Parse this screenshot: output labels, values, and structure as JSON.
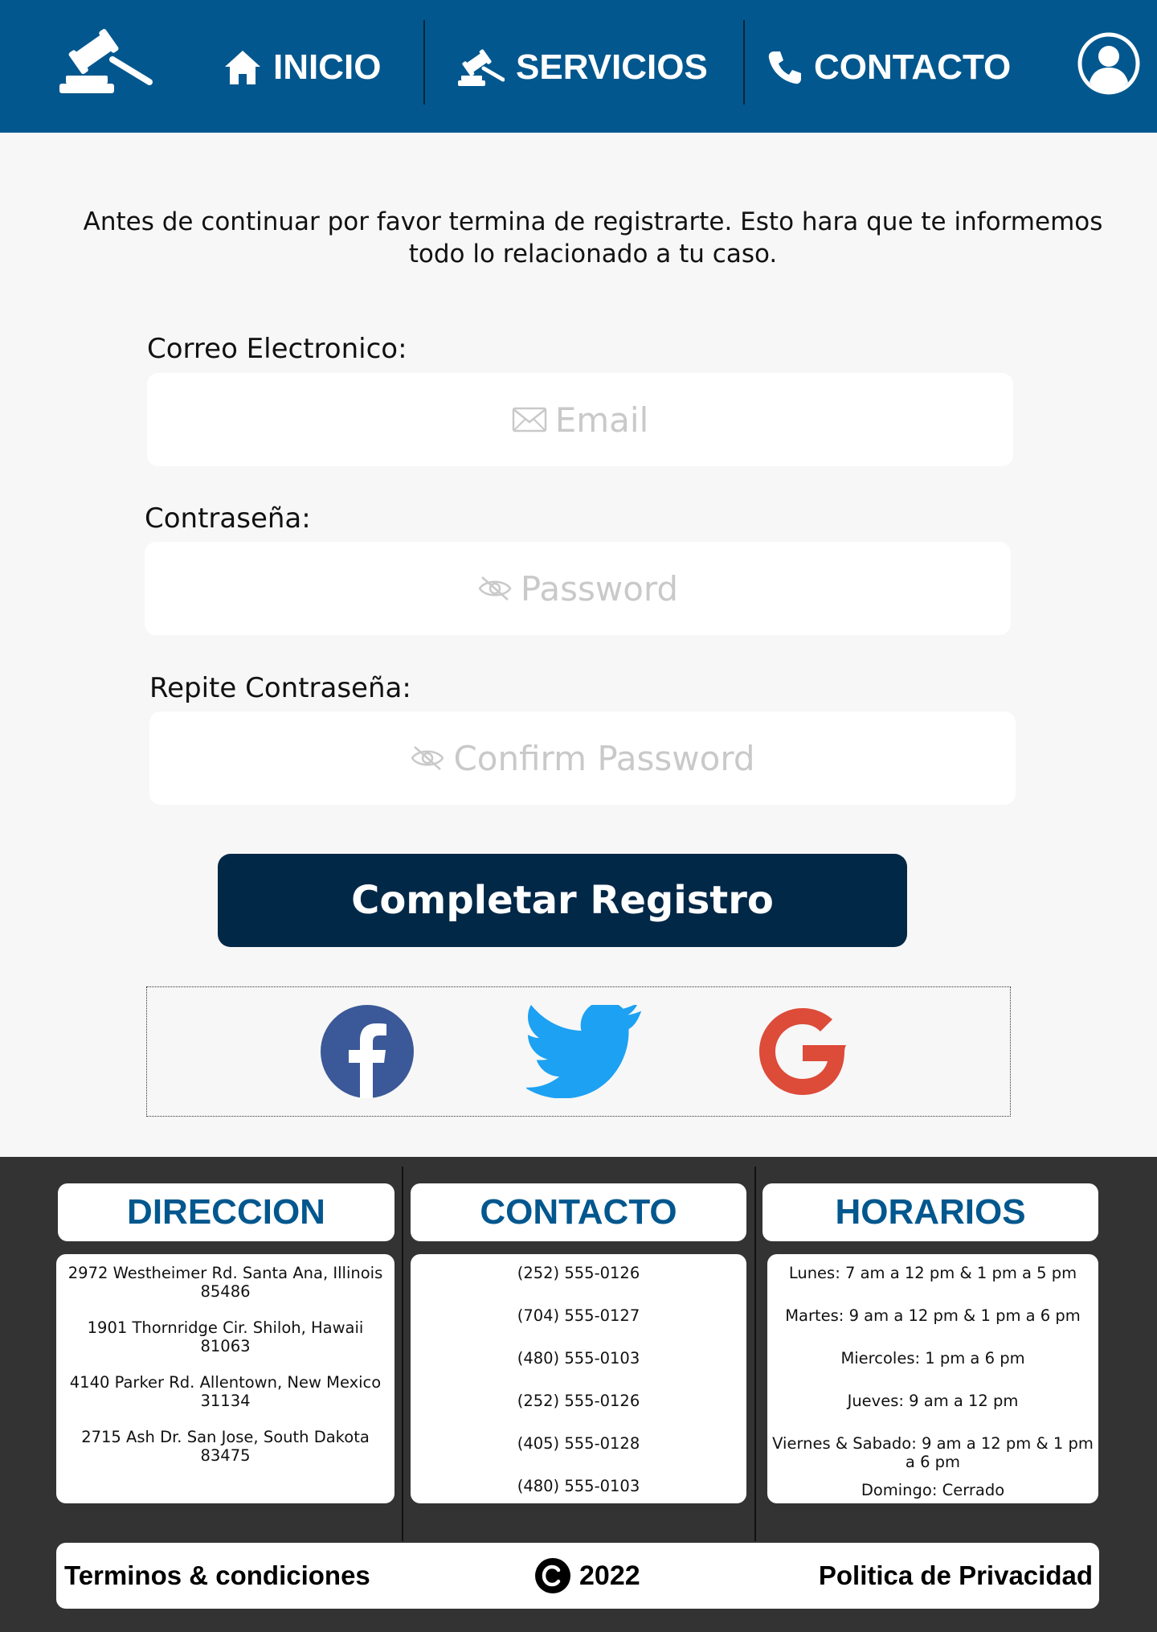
{
  "colors": {
    "header_bg": "#02578e",
    "button_bg": "#022848",
    "footer_bg": "#333333",
    "heading_blue": "#02578e"
  },
  "nav": {
    "logo_icon": "gavel-icon",
    "items": [
      {
        "label": "INICIO",
        "icon": "home-icon"
      },
      {
        "label": "SERVICIOS",
        "icon": "gavel-icon"
      },
      {
        "label": "CONTACTO",
        "icon": "phone-icon"
      }
    ],
    "user_icon": "user-circle-icon"
  },
  "form": {
    "intro": "Antes de continuar por favor termina de registrarte. Esto hara que te informemos todo lo relacionado a tu caso.",
    "email_label": "Correo Electronico:",
    "email_placeholder": "Email",
    "password_label": "Contraseña:",
    "password_placeholder": "Password",
    "confirm_label": "Repite Contraseña:",
    "confirm_placeholder": "Confirm Password",
    "submit_label": "Completar Registro",
    "social": [
      "facebook-icon",
      "twitter-icon",
      "google-icon"
    ]
  },
  "footer": {
    "direccion": {
      "title": "DIRECCION",
      "rows": [
        "2972 Westheimer Rd. Santa Ana, Illinois 85486",
        "1901 Thornridge Cir. Shiloh, Hawaii 81063",
        "4140 Parker Rd. Allentown, New Mexico 31134",
        "2715 Ash Dr. San Jose, South Dakota 83475"
      ]
    },
    "contacto": {
      "title": "CONTACTO",
      "rows": [
        "(252) 555-0126",
        "(704) 555-0127",
        "(480) 555-0103",
        "(252) 555-0126",
        "(405) 555-0128",
        "(480) 555-0103"
      ]
    },
    "horarios": {
      "title": "HORARIOS",
      "rows": [
        "Lunes: 7 am a 12 pm & 1 pm a 5 pm",
        "Martes: 9 am a 12 pm & 1 pm a 6 pm",
        "Miercoles: 1 pm a 6 pm",
        "Jueves: 9 am a 12 pm",
        "Viernes & Sabado: 9 am a 12 pm & 1 pm a 6 pm",
        "Domingo: Cerrado"
      ]
    },
    "terms": "Terminos & condiciones",
    "copyright_year": "2022",
    "copyright_icon": "copyright-icon",
    "privacy": "Politica de Privacidad"
  }
}
